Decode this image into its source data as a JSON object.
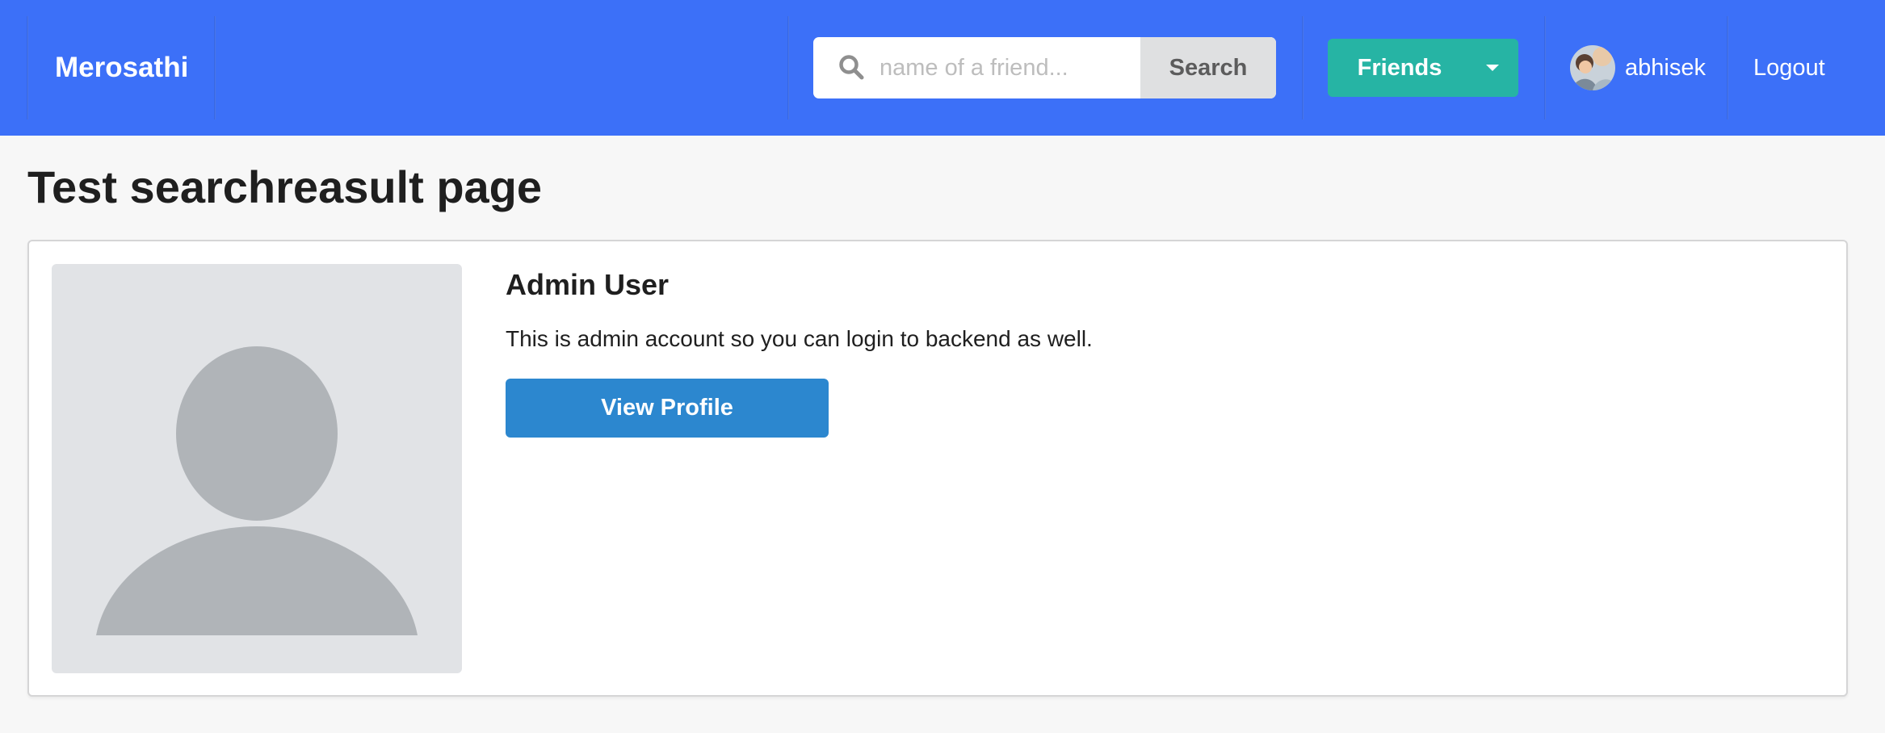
{
  "navbar": {
    "brand": "Merosathi",
    "background_color": "#3c70f8",
    "search": {
      "placeholder": "name of a friend...",
      "value": "",
      "button_label": "Search",
      "icon": "search-icon"
    },
    "friends_button": {
      "label": "Friends",
      "color": "#26b4a4",
      "icon": "caret-down-icon"
    },
    "user": {
      "username": "abhisek",
      "avatar": "user-avatar"
    },
    "logout_label": "Logout"
  },
  "main": {
    "page_title": "Test searchreasult page",
    "results": [
      {
        "name": "Admin User",
        "description": "This is admin account so you can login to backend as well.",
        "image": "default-user-placeholder",
        "button_label": "View Profile",
        "button_color": "#2c87cf"
      }
    ]
  }
}
